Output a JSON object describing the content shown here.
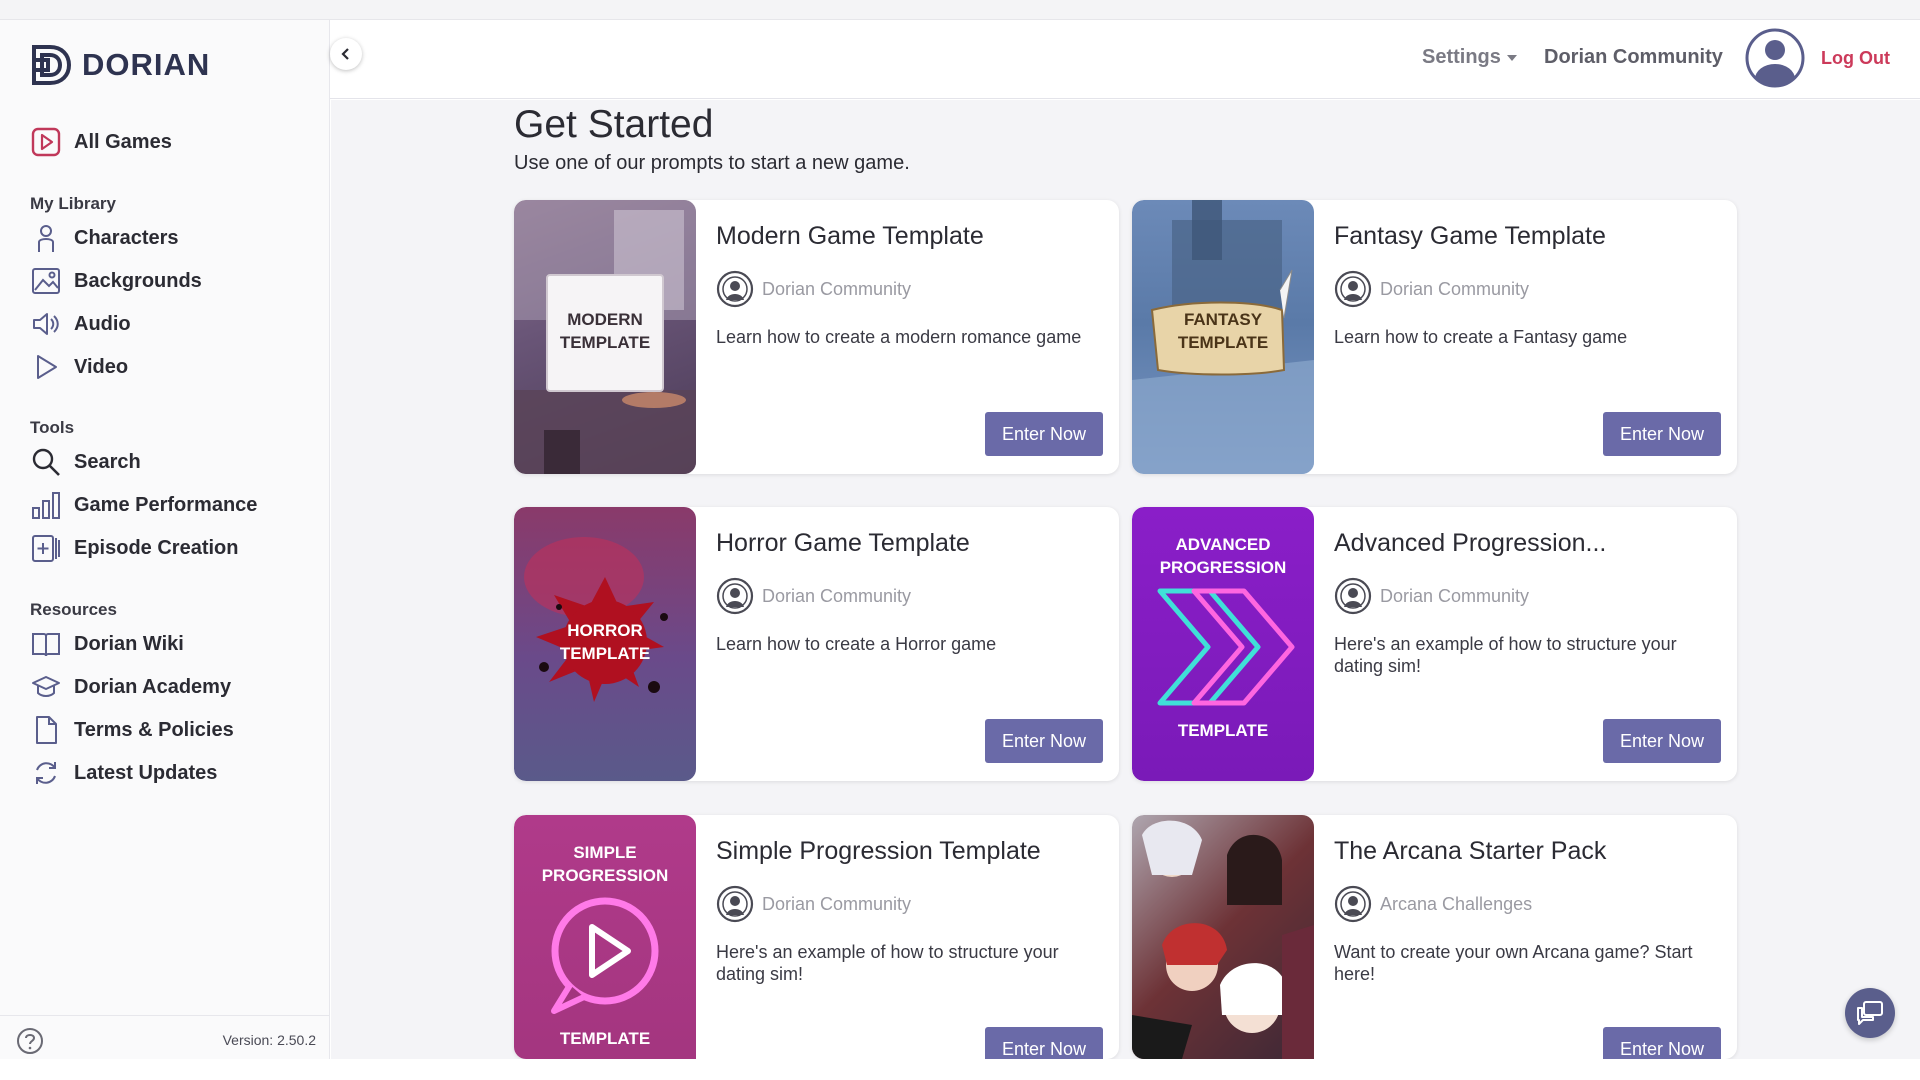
{
  "app": {
    "brand": "DORIAN",
    "version_label": "Version: 2.50.2"
  },
  "sidebar": {
    "all_games": "All Games",
    "sections": [
      {
        "title": "My Library",
        "items": [
          "Characters",
          "Backgrounds",
          "Audio",
          "Video"
        ]
      },
      {
        "title": "Tools",
        "items": [
          "Search",
          "Game Performance",
          "Episode Creation"
        ]
      },
      {
        "title": "Resources",
        "items": [
          "Dorian Wiki",
          "Dorian Academy",
          "Terms & Policies",
          "Latest Updates"
        ]
      }
    ]
  },
  "header": {
    "settings": "Settings",
    "community": "Dorian Community",
    "logout": "Log Out"
  },
  "main": {
    "title": "Get Started",
    "subtitle": "Use one of our prompts to start a new game.",
    "cards": [
      {
        "title": "Modern Game Template",
        "author": "Dorian Community",
        "description": "Learn how to create a modern romance game",
        "button": "Enter Now",
        "thumb_text": [
          "MODERN",
          "TEMPLATE"
        ]
      },
      {
        "title": "Fantasy Game Template",
        "author": "Dorian Community",
        "description": "Learn how to create a Fantasy game",
        "button": "Enter Now",
        "thumb_text": [
          "FANTASY",
          "TEMPLATE"
        ]
      },
      {
        "title": "Horror Game Template",
        "author": "Dorian Community",
        "description": "Learn how to create a Horror game",
        "button": "Enter Now",
        "thumb_text": [
          "HORROR",
          "TEMPLATE"
        ]
      },
      {
        "title": "Advanced Progression...",
        "author": "Dorian Community",
        "description": "Here's an example of how to structure your dating sim!",
        "button": "Enter Now",
        "thumb_text": [
          "ADVANCED",
          "PROGRESSION",
          "TEMPLATE"
        ]
      },
      {
        "title": "Simple Progression Template",
        "author": "Dorian Community",
        "description": "Here's an example of how to structure your dating sim!",
        "button": "Enter Now",
        "thumb_text": [
          "SIMPLE",
          "PROGRESSION",
          "TEMPLATE"
        ]
      },
      {
        "title": "The Arcana Starter Pack",
        "author": "Arcana Challenges",
        "description": "Want to create your own Arcana game? Start here!",
        "button": "Enter Now",
        "thumb_text": []
      }
    ]
  },
  "colors": {
    "accent": "#6a6aa8",
    "logout": "#cc3a5a",
    "brand": "#2e3350",
    "nav_icon": "#5a5e8c",
    "all_games_icon": "#c0385a"
  }
}
